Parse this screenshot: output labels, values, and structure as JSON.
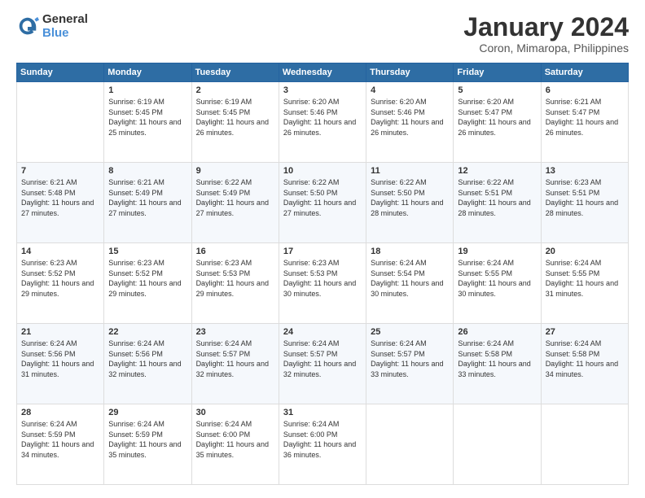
{
  "logo": {
    "general": "General",
    "blue": "Blue"
  },
  "title": {
    "month": "January 2024",
    "location": "Coron, Mimaropa, Philippines"
  },
  "headers": [
    "Sunday",
    "Monday",
    "Tuesday",
    "Wednesday",
    "Thursday",
    "Friday",
    "Saturday"
  ],
  "weeks": [
    [
      {
        "day": "",
        "sunrise": "",
        "sunset": "",
        "daylight": ""
      },
      {
        "day": "1",
        "sunrise": "Sunrise: 6:19 AM",
        "sunset": "Sunset: 5:45 PM",
        "daylight": "Daylight: 11 hours and 25 minutes."
      },
      {
        "day": "2",
        "sunrise": "Sunrise: 6:19 AM",
        "sunset": "Sunset: 5:45 PM",
        "daylight": "Daylight: 11 hours and 26 minutes."
      },
      {
        "day": "3",
        "sunrise": "Sunrise: 6:20 AM",
        "sunset": "Sunset: 5:46 PM",
        "daylight": "Daylight: 11 hours and 26 minutes."
      },
      {
        "day": "4",
        "sunrise": "Sunrise: 6:20 AM",
        "sunset": "Sunset: 5:46 PM",
        "daylight": "Daylight: 11 hours and 26 minutes."
      },
      {
        "day": "5",
        "sunrise": "Sunrise: 6:20 AM",
        "sunset": "Sunset: 5:47 PM",
        "daylight": "Daylight: 11 hours and 26 minutes."
      },
      {
        "day": "6",
        "sunrise": "Sunrise: 6:21 AM",
        "sunset": "Sunset: 5:47 PM",
        "daylight": "Daylight: 11 hours and 26 minutes."
      }
    ],
    [
      {
        "day": "7",
        "sunrise": "Sunrise: 6:21 AM",
        "sunset": "Sunset: 5:48 PM",
        "daylight": "Daylight: 11 hours and 27 minutes."
      },
      {
        "day": "8",
        "sunrise": "Sunrise: 6:21 AM",
        "sunset": "Sunset: 5:49 PM",
        "daylight": "Daylight: 11 hours and 27 minutes."
      },
      {
        "day": "9",
        "sunrise": "Sunrise: 6:22 AM",
        "sunset": "Sunset: 5:49 PM",
        "daylight": "Daylight: 11 hours and 27 minutes."
      },
      {
        "day": "10",
        "sunrise": "Sunrise: 6:22 AM",
        "sunset": "Sunset: 5:50 PM",
        "daylight": "Daylight: 11 hours and 27 minutes."
      },
      {
        "day": "11",
        "sunrise": "Sunrise: 6:22 AM",
        "sunset": "Sunset: 5:50 PM",
        "daylight": "Daylight: 11 hours and 28 minutes."
      },
      {
        "day": "12",
        "sunrise": "Sunrise: 6:22 AM",
        "sunset": "Sunset: 5:51 PM",
        "daylight": "Daylight: 11 hours and 28 minutes."
      },
      {
        "day": "13",
        "sunrise": "Sunrise: 6:23 AM",
        "sunset": "Sunset: 5:51 PM",
        "daylight": "Daylight: 11 hours and 28 minutes."
      }
    ],
    [
      {
        "day": "14",
        "sunrise": "Sunrise: 6:23 AM",
        "sunset": "Sunset: 5:52 PM",
        "daylight": "Daylight: 11 hours and 29 minutes."
      },
      {
        "day": "15",
        "sunrise": "Sunrise: 6:23 AM",
        "sunset": "Sunset: 5:52 PM",
        "daylight": "Daylight: 11 hours and 29 minutes."
      },
      {
        "day": "16",
        "sunrise": "Sunrise: 6:23 AM",
        "sunset": "Sunset: 5:53 PM",
        "daylight": "Daylight: 11 hours and 29 minutes."
      },
      {
        "day": "17",
        "sunrise": "Sunrise: 6:23 AM",
        "sunset": "Sunset: 5:53 PM",
        "daylight": "Daylight: 11 hours and 30 minutes."
      },
      {
        "day": "18",
        "sunrise": "Sunrise: 6:24 AM",
        "sunset": "Sunset: 5:54 PM",
        "daylight": "Daylight: 11 hours and 30 minutes."
      },
      {
        "day": "19",
        "sunrise": "Sunrise: 6:24 AM",
        "sunset": "Sunset: 5:55 PM",
        "daylight": "Daylight: 11 hours and 30 minutes."
      },
      {
        "day": "20",
        "sunrise": "Sunrise: 6:24 AM",
        "sunset": "Sunset: 5:55 PM",
        "daylight": "Daylight: 11 hours and 31 minutes."
      }
    ],
    [
      {
        "day": "21",
        "sunrise": "Sunrise: 6:24 AM",
        "sunset": "Sunset: 5:56 PM",
        "daylight": "Daylight: 11 hours and 31 minutes."
      },
      {
        "day": "22",
        "sunrise": "Sunrise: 6:24 AM",
        "sunset": "Sunset: 5:56 PM",
        "daylight": "Daylight: 11 hours and 32 minutes."
      },
      {
        "day": "23",
        "sunrise": "Sunrise: 6:24 AM",
        "sunset": "Sunset: 5:57 PM",
        "daylight": "Daylight: 11 hours and 32 minutes."
      },
      {
        "day": "24",
        "sunrise": "Sunrise: 6:24 AM",
        "sunset": "Sunset: 5:57 PM",
        "daylight": "Daylight: 11 hours and 32 minutes."
      },
      {
        "day": "25",
        "sunrise": "Sunrise: 6:24 AM",
        "sunset": "Sunset: 5:57 PM",
        "daylight": "Daylight: 11 hours and 33 minutes."
      },
      {
        "day": "26",
        "sunrise": "Sunrise: 6:24 AM",
        "sunset": "Sunset: 5:58 PM",
        "daylight": "Daylight: 11 hours and 33 minutes."
      },
      {
        "day": "27",
        "sunrise": "Sunrise: 6:24 AM",
        "sunset": "Sunset: 5:58 PM",
        "daylight": "Daylight: 11 hours and 34 minutes."
      }
    ],
    [
      {
        "day": "28",
        "sunrise": "Sunrise: 6:24 AM",
        "sunset": "Sunset: 5:59 PM",
        "daylight": "Daylight: 11 hours and 34 minutes."
      },
      {
        "day": "29",
        "sunrise": "Sunrise: 6:24 AM",
        "sunset": "Sunset: 5:59 PM",
        "daylight": "Daylight: 11 hours and 35 minutes."
      },
      {
        "day": "30",
        "sunrise": "Sunrise: 6:24 AM",
        "sunset": "Sunset: 6:00 PM",
        "daylight": "Daylight: 11 hours and 35 minutes."
      },
      {
        "day": "31",
        "sunrise": "Sunrise: 6:24 AM",
        "sunset": "Sunset: 6:00 PM",
        "daylight": "Daylight: 11 hours and 36 minutes."
      },
      {
        "day": "",
        "sunrise": "",
        "sunset": "",
        "daylight": ""
      },
      {
        "day": "",
        "sunrise": "",
        "sunset": "",
        "daylight": ""
      },
      {
        "day": "",
        "sunrise": "",
        "sunset": "",
        "daylight": ""
      }
    ]
  ]
}
